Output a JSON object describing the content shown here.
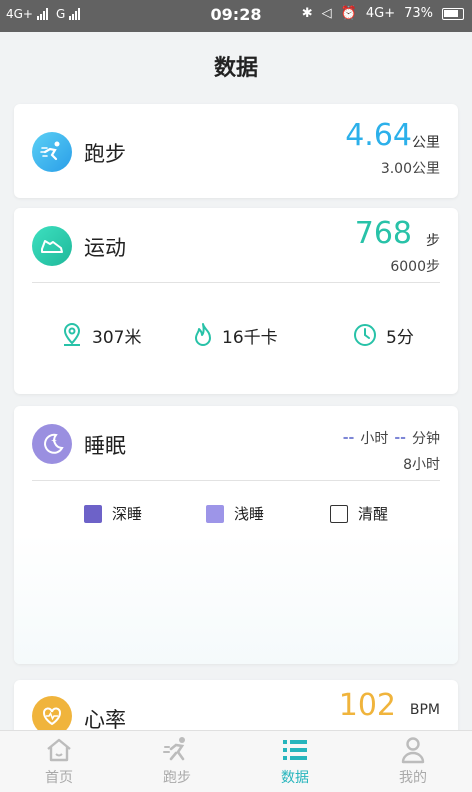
{
  "status": {
    "network_left": "4G+",
    "network_g": "G",
    "time": "09:28",
    "network_right": "4G+",
    "battery": "73%"
  },
  "page": {
    "title": "数据"
  },
  "running": {
    "title": "跑步",
    "value": "4.64",
    "unit": "公里",
    "goal": "3.00公里",
    "accent": "#2cb0ea"
  },
  "exercise": {
    "title": "运动",
    "value": "768",
    "unit": "步",
    "goal": "6000步",
    "accent": "#28c2a8",
    "distance": "307米",
    "calories": "16千卡",
    "duration": "5分"
  },
  "sleep": {
    "title": "睡眠",
    "hours_placeholder": "--",
    "hours_unit": "小时",
    "minutes_placeholder": "--",
    "minutes_unit": "分钟",
    "goal": "8小时",
    "legend": {
      "deep": "深睡",
      "light": "浅睡",
      "awake": "清醒"
    },
    "colors": {
      "deep": "#6d62c8",
      "light": "#9d95e8",
      "icon": "#9a8fe0"
    }
  },
  "heart": {
    "title": "心率",
    "value": "102",
    "unit": "BPM",
    "accent": "#f0b43c"
  },
  "tabs": [
    {
      "label": "首页",
      "icon": "home-icon"
    },
    {
      "label": "跑步",
      "icon": "runner-icon"
    },
    {
      "label": "数据",
      "icon": "list-icon"
    },
    {
      "label": "我的",
      "icon": "profile-icon"
    }
  ]
}
